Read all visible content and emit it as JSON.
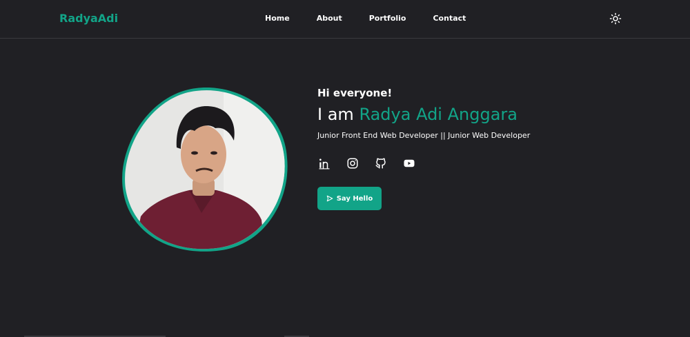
{
  "brand": {
    "logo": "RadyaAdi",
    "accent": "#12a488",
    "background": "#202024"
  },
  "nav": {
    "items": [
      {
        "label": "Home"
      },
      {
        "label": "About"
      },
      {
        "label": "Portfolio"
      },
      {
        "label": "Contact"
      }
    ],
    "theme_icon": "sun-icon"
  },
  "hero": {
    "greeting": "Hi everyone!",
    "intro": "I am",
    "name": "Radya Adi Anggara",
    "role": "Junior Front End Web Developer || Junior Web Developer",
    "photo_alt": "profile-photo",
    "socials": [
      {
        "icon": "linkedin-icon"
      },
      {
        "icon": "instagram-icon"
      },
      {
        "icon": "github-icon"
      },
      {
        "icon": "youtube-icon"
      }
    ],
    "cta": {
      "label": "Say Hello",
      "icon": "send-icon"
    }
  }
}
